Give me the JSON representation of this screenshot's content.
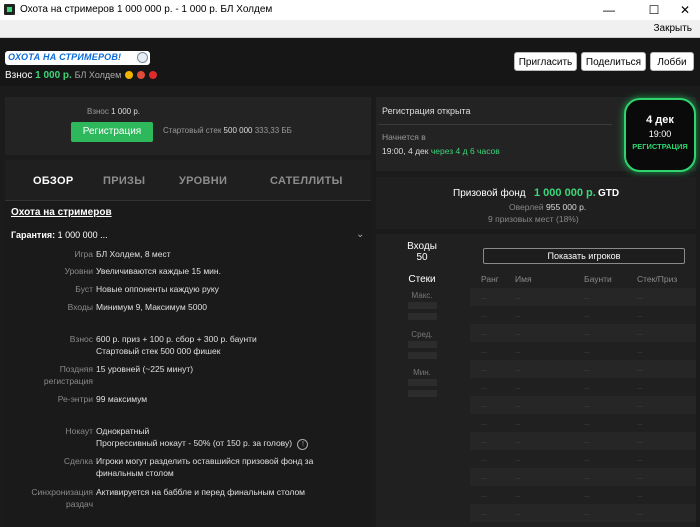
{
  "window": {
    "title": "Охота на стримеров 1 000 000 р.  - 1 000 р. БЛ Холдем",
    "controls": [
      "—",
      "☐",
      "✕"
    ]
  },
  "menubar": {
    "close_label": "Закрыть"
  },
  "header": {
    "logo_text": "ОХОТА НА СТРИМЕРОВ!",
    "buyin_label": "Взнос",
    "buyin_amount": "1 000 р.",
    "game_type": "БЛ Холдем",
    "chip_colors": [
      "#f0b400",
      "#e04b3a",
      "#e02b2b"
    ],
    "buttons": [
      "Пригласить",
      "Поделиться",
      "Лобби"
    ]
  },
  "left_top": {
    "fee_label": "Взнос",
    "fee_value": "1 000 р.",
    "register_button": "Регистрация",
    "stack_label": "Стартовый стек",
    "stack_value": "500 000",
    "stack_bb": "333,33 ББ"
  },
  "tabs": [
    "ОБЗОР",
    "ПРИЗЫ",
    "УРОВНИ",
    "САТЕЛЛИТЫ"
  ],
  "overview": {
    "title": "Охота на стримеров",
    "guarantee_label": "Гарантия:",
    "guarantee_value": "1 000 000 ...",
    "details": [
      {
        "key": "Игра",
        "value": "БЛ Холдем, 8 мест"
      },
      {
        "key": "Уровни",
        "value": "Увеличиваются каждые 15 мин."
      },
      {
        "key": "Буст",
        "value": "Новые оппоненты каждую руку"
      },
      {
        "key": "Входы",
        "value": "Минимум 9, Максимум 5000"
      },
      {
        "key": "Взнос",
        "value": "600 р. приз + 100 р. сбор + 300 р. баунти",
        "value2": "Стартовый стек 500 000 фишек"
      },
      {
        "key": "Поздняя",
        "key2": "регистрация",
        "value": "15 уровней (~225 минут)"
      },
      {
        "key": "Ре-энтри",
        "value": "99 максимум"
      },
      {
        "key": "Нокаут",
        "value": "Однократный",
        "value2": "Прогрессивный нокаут - 50% (от 150 р. за голову)"
      },
      {
        "key": "Сделка",
        "value": "Игроки могут разделить оставшийся призовой фонд за",
        "value2": "финальным столом"
      },
      {
        "key": "Синхронизация",
        "key2": "раздач",
        "value": "Активируется на баббле и перед финальным столом"
      }
    ]
  },
  "registration": {
    "status": "Регистрация открыта",
    "starts_label": "Начнется в",
    "start_time": "19:00, 4 дек",
    "relative": "через 4 д 6 часов"
  },
  "badge": {
    "date": "4 дек",
    "time": "19:00",
    "label": "РЕГИСТРАЦИЯ"
  },
  "prize": {
    "label": "Призовой фонд",
    "amount": "1 000 000 р.",
    "gtd": "GTD",
    "overlay_label": "Оверлей",
    "overlay_value": "955 000 р.",
    "places": "9 призовых мест (18%)"
  },
  "players": {
    "entries_label": "Входы",
    "entries_value": "50",
    "stacks_label": "Стеки",
    "stack_rows": [
      "Макс.",
      "Сред.",
      "Мин."
    ],
    "show_button": "Показать игроков",
    "columns": [
      "Ранг",
      "Имя",
      "Баунти",
      "Стек/Приз"
    ],
    "placeholder": "..."
  },
  "colors": {
    "accent": "#3cd67a",
    "button_green": "#2eb85c"
  }
}
